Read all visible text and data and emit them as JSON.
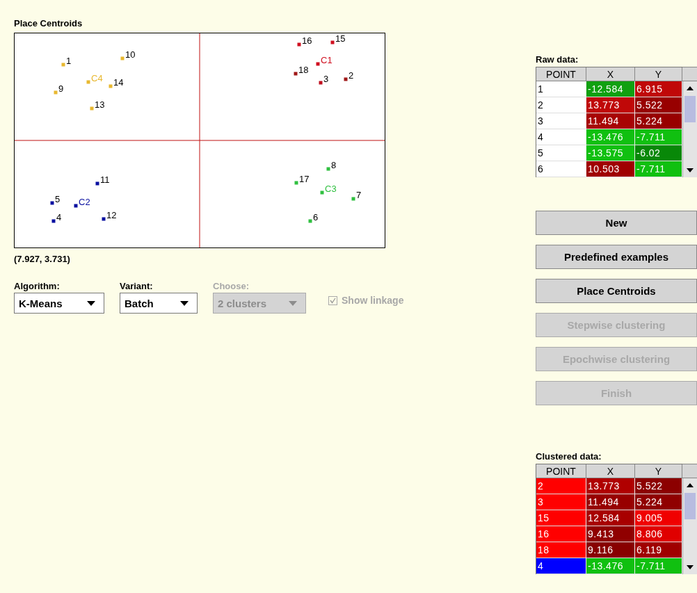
{
  "plot": {
    "title": "Place Centroids",
    "coordinates": "(7.927, 3.731)",
    "points": [
      {
        "label": "16",
        "kind": "point",
        "color": "#d01020"
      },
      {
        "label": "15",
        "kind": "point",
        "color": "#d01020"
      },
      {
        "label": "C1",
        "kind": "centroid",
        "color": "#d01020"
      },
      {
        "label": "18",
        "kind": "point",
        "color": "#a01818"
      },
      {
        "label": "3",
        "kind": "point",
        "color": "#c01020"
      },
      {
        "label": "2",
        "kind": "point",
        "color": "#a01818"
      },
      {
        "label": "1",
        "kind": "point",
        "color": "#e8b830"
      },
      {
        "label": "10",
        "kind": "point",
        "color": "#e8b830"
      },
      {
        "label": "C4",
        "kind": "centroid",
        "color": "#e8b830"
      },
      {
        "label": "14",
        "kind": "point",
        "color": "#e8b830"
      },
      {
        "label": "9",
        "kind": "point",
        "color": "#e8b830"
      },
      {
        "label": "13",
        "kind": "point",
        "color": "#e8b830"
      },
      {
        "label": "11",
        "kind": "point",
        "color": "#0a10a0"
      },
      {
        "label": "5",
        "kind": "point",
        "color": "#0a10a0"
      },
      {
        "label": "C2",
        "kind": "centroid",
        "color": "#0a10a0"
      },
      {
        "label": "4",
        "kind": "point",
        "color": "#0a10a0"
      },
      {
        "label": "12",
        "kind": "point",
        "color": "#0a10a0"
      },
      {
        "label": "8",
        "kind": "point",
        "color": "#30c040"
      },
      {
        "label": "17",
        "kind": "point",
        "color": "#30c040"
      },
      {
        "label": "C3",
        "kind": "centroid",
        "color": "#30c040"
      },
      {
        "label": "7",
        "kind": "point",
        "color": "#30c040"
      },
      {
        "label": "6",
        "kind": "point",
        "color": "#30c040"
      }
    ]
  },
  "controls": [
    {
      "label": "Algorithm:",
      "kind": "dropdown",
      "value": "K-Means",
      "disabled": false
    },
    {
      "label": "Variant:",
      "kind": "dropdown",
      "value": "Batch",
      "disabled": false
    },
    {
      "label": "Choose:",
      "kind": "dropdown",
      "value": "2 clusters",
      "disabled": true
    },
    {
      "label": "Show linkage",
      "kind": "checkbox",
      "checked": true,
      "disabled": true
    }
  ],
  "raw_data": {
    "title": "Raw data:",
    "columns": [
      "POINT",
      "X",
      "Y"
    ],
    "rows": [
      {
        "cells": [
          {
            "text": "1",
            "color": "#ffffff"
          },
          {
            "text": "-12.584",
            "color": "#10a010"
          },
          {
            "text": "6.915",
            "color": "#c00808"
          }
        ]
      },
      {
        "cells": [
          {
            "text": "2",
            "color": "#ffffff"
          },
          {
            "text": "13.773",
            "color": "#c00808"
          },
          {
            "text": "5.522",
            "color": "#980000"
          }
        ]
      },
      {
        "cells": [
          {
            "text": "3",
            "color": "#ffffff"
          },
          {
            "text": "11.494",
            "color": "#a80404"
          },
          {
            "text": "5.224",
            "color": "#980000"
          }
        ]
      },
      {
        "cells": [
          {
            "text": "4",
            "color": "#ffffff"
          },
          {
            "text": "-13.476",
            "color": "#10c010"
          },
          {
            "text": "-7.711",
            "color": "#10c010"
          }
        ]
      },
      {
        "cells": [
          {
            "text": "5",
            "color": "#ffffff"
          },
          {
            "text": "-13.575",
            "color": "#10c010"
          },
          {
            "text": "-6.02",
            "color": "#088808"
          }
        ]
      },
      {
        "cells": [
          {
            "text": "6",
            "color": "#ffffff"
          },
          {
            "text": "10.503",
            "color": "#a00000"
          },
          {
            "text": "-7.711",
            "color": "#10c010"
          }
        ]
      }
    ]
  },
  "buttons": [
    {
      "label": "New",
      "disabled": false
    },
    {
      "label": "Predefined examples",
      "disabled": false
    },
    {
      "label": "Place Centroids",
      "disabled": false
    },
    {
      "label": "Stepwise clustering",
      "disabled": true
    },
    {
      "label": "Epochwise clustering",
      "disabled": true
    },
    {
      "label": "Finish",
      "disabled": true
    }
  ],
  "clustered_data": {
    "title": "Clustered data:",
    "columns": [
      "POINT",
      "X",
      "Y"
    ],
    "rows": [
      {
        "cells": [
          {
            "text": "2",
            "color": "#ff0000"
          },
          {
            "text": "13.773",
            "color": "#b00000"
          },
          {
            "text": "5.522",
            "color": "#8c0000"
          }
        ]
      },
      {
        "cells": [
          {
            "text": "3",
            "color": "#ff0000"
          },
          {
            "text": "11.494",
            "color": "#980000"
          },
          {
            "text": "5.224",
            "color": "#900000"
          }
        ]
      },
      {
        "cells": [
          {
            "text": "15",
            "color": "#ff0000"
          },
          {
            "text": "12.584",
            "color": "#a80000"
          },
          {
            "text": "9.005",
            "color": "#f00000"
          }
        ]
      },
      {
        "cells": [
          {
            "text": "16",
            "color": "#ff0000"
          },
          {
            "text": "9.413",
            "color": "#900000"
          },
          {
            "text": "8.806",
            "color": "#e00000"
          }
        ]
      },
      {
        "cells": [
          {
            "text": "18",
            "color": "#ff0000"
          },
          {
            "text": "9.116",
            "color": "#880000"
          },
          {
            "text": "6.119",
            "color": "#a00000"
          }
        ]
      },
      {
        "cells": [
          {
            "text": "4",
            "color": "#0000ff"
          },
          {
            "text": "-13.476",
            "color": "#10c010"
          },
          {
            "text": "-7.711",
            "color": "#10c010"
          }
        ]
      }
    ]
  }
}
